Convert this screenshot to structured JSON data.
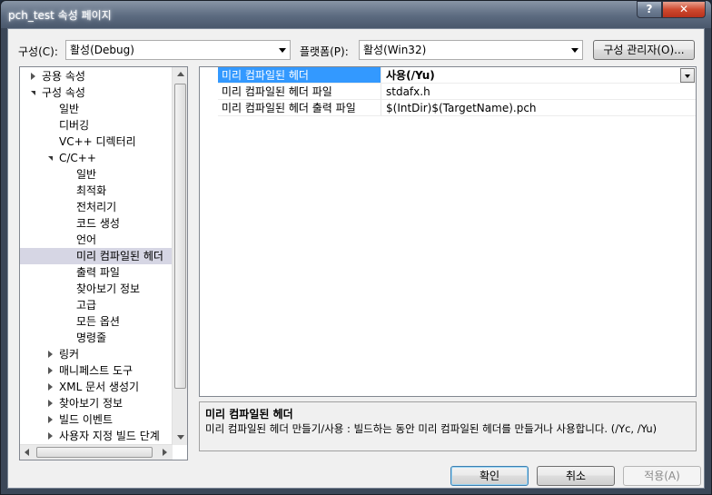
{
  "window": {
    "title": "pch_test 속성 페이지",
    "help_label": "?",
    "close_label": "✕"
  },
  "toolbar": {
    "config_label": "구성(C):",
    "config_value": "활성(Debug)",
    "platform_label": "플랫폼(P):",
    "platform_value": "활성(Win32)",
    "config_manager_label": "구성 관리자(O)..."
  },
  "tree": {
    "items": [
      {
        "label": "공용 속성",
        "state": "collapsed"
      },
      {
        "label": "구성 속성",
        "state": "expanded"
      },
      {
        "label": "일반"
      },
      {
        "label": "디버깅"
      },
      {
        "label": "VC++ 디렉터리"
      },
      {
        "label": "C/C++",
        "state": "expanded"
      },
      {
        "label": "일반"
      },
      {
        "label": "최적화"
      },
      {
        "label": "전처리기"
      },
      {
        "label": "코드 생성"
      },
      {
        "label": "언어"
      },
      {
        "label": "미리 컴파일된 헤더",
        "selected": true
      },
      {
        "label": "출력 파일"
      },
      {
        "label": "찾아보기 정보"
      },
      {
        "label": "고급"
      },
      {
        "label": "모든 옵션"
      },
      {
        "label": "명령줄"
      },
      {
        "label": "링커",
        "state": "collapsed"
      },
      {
        "label": "매니페스트 도구",
        "state": "collapsed"
      },
      {
        "label": "XML 문서 생성기",
        "state": "collapsed"
      },
      {
        "label": "찾아보기 정보",
        "state": "collapsed"
      },
      {
        "label": "빌드 이벤트",
        "state": "collapsed"
      },
      {
        "label": "사용자 지정 빌드 단계",
        "state": "collapsed"
      }
    ]
  },
  "properties": {
    "rows": [
      {
        "name": "미리 컴파일된 헤더",
        "value": "사용(/Yu)",
        "selected": true
      },
      {
        "name": "미리 컴파일된 헤더 파일",
        "value": "stdafx.h"
      },
      {
        "name": "미리 컴파일된 헤더 출력 파일",
        "value": "$(IntDir)$(TargetName).pch"
      }
    ]
  },
  "description": {
    "title": "미리 컴파일된 헤더",
    "body": "미리 컴파일된 헤더 만들기/사용 : 빌드하는 동안 미리 컴파일된 헤더를 만들거나 사용합니다. (/Yc, /Yu)"
  },
  "footer": {
    "ok_label": "확인",
    "cancel_label": "취소",
    "apply_label": "적용(A)"
  },
  "colors": {
    "selection": "#3399ff",
    "tree_selection": "#d6d6e4"
  }
}
